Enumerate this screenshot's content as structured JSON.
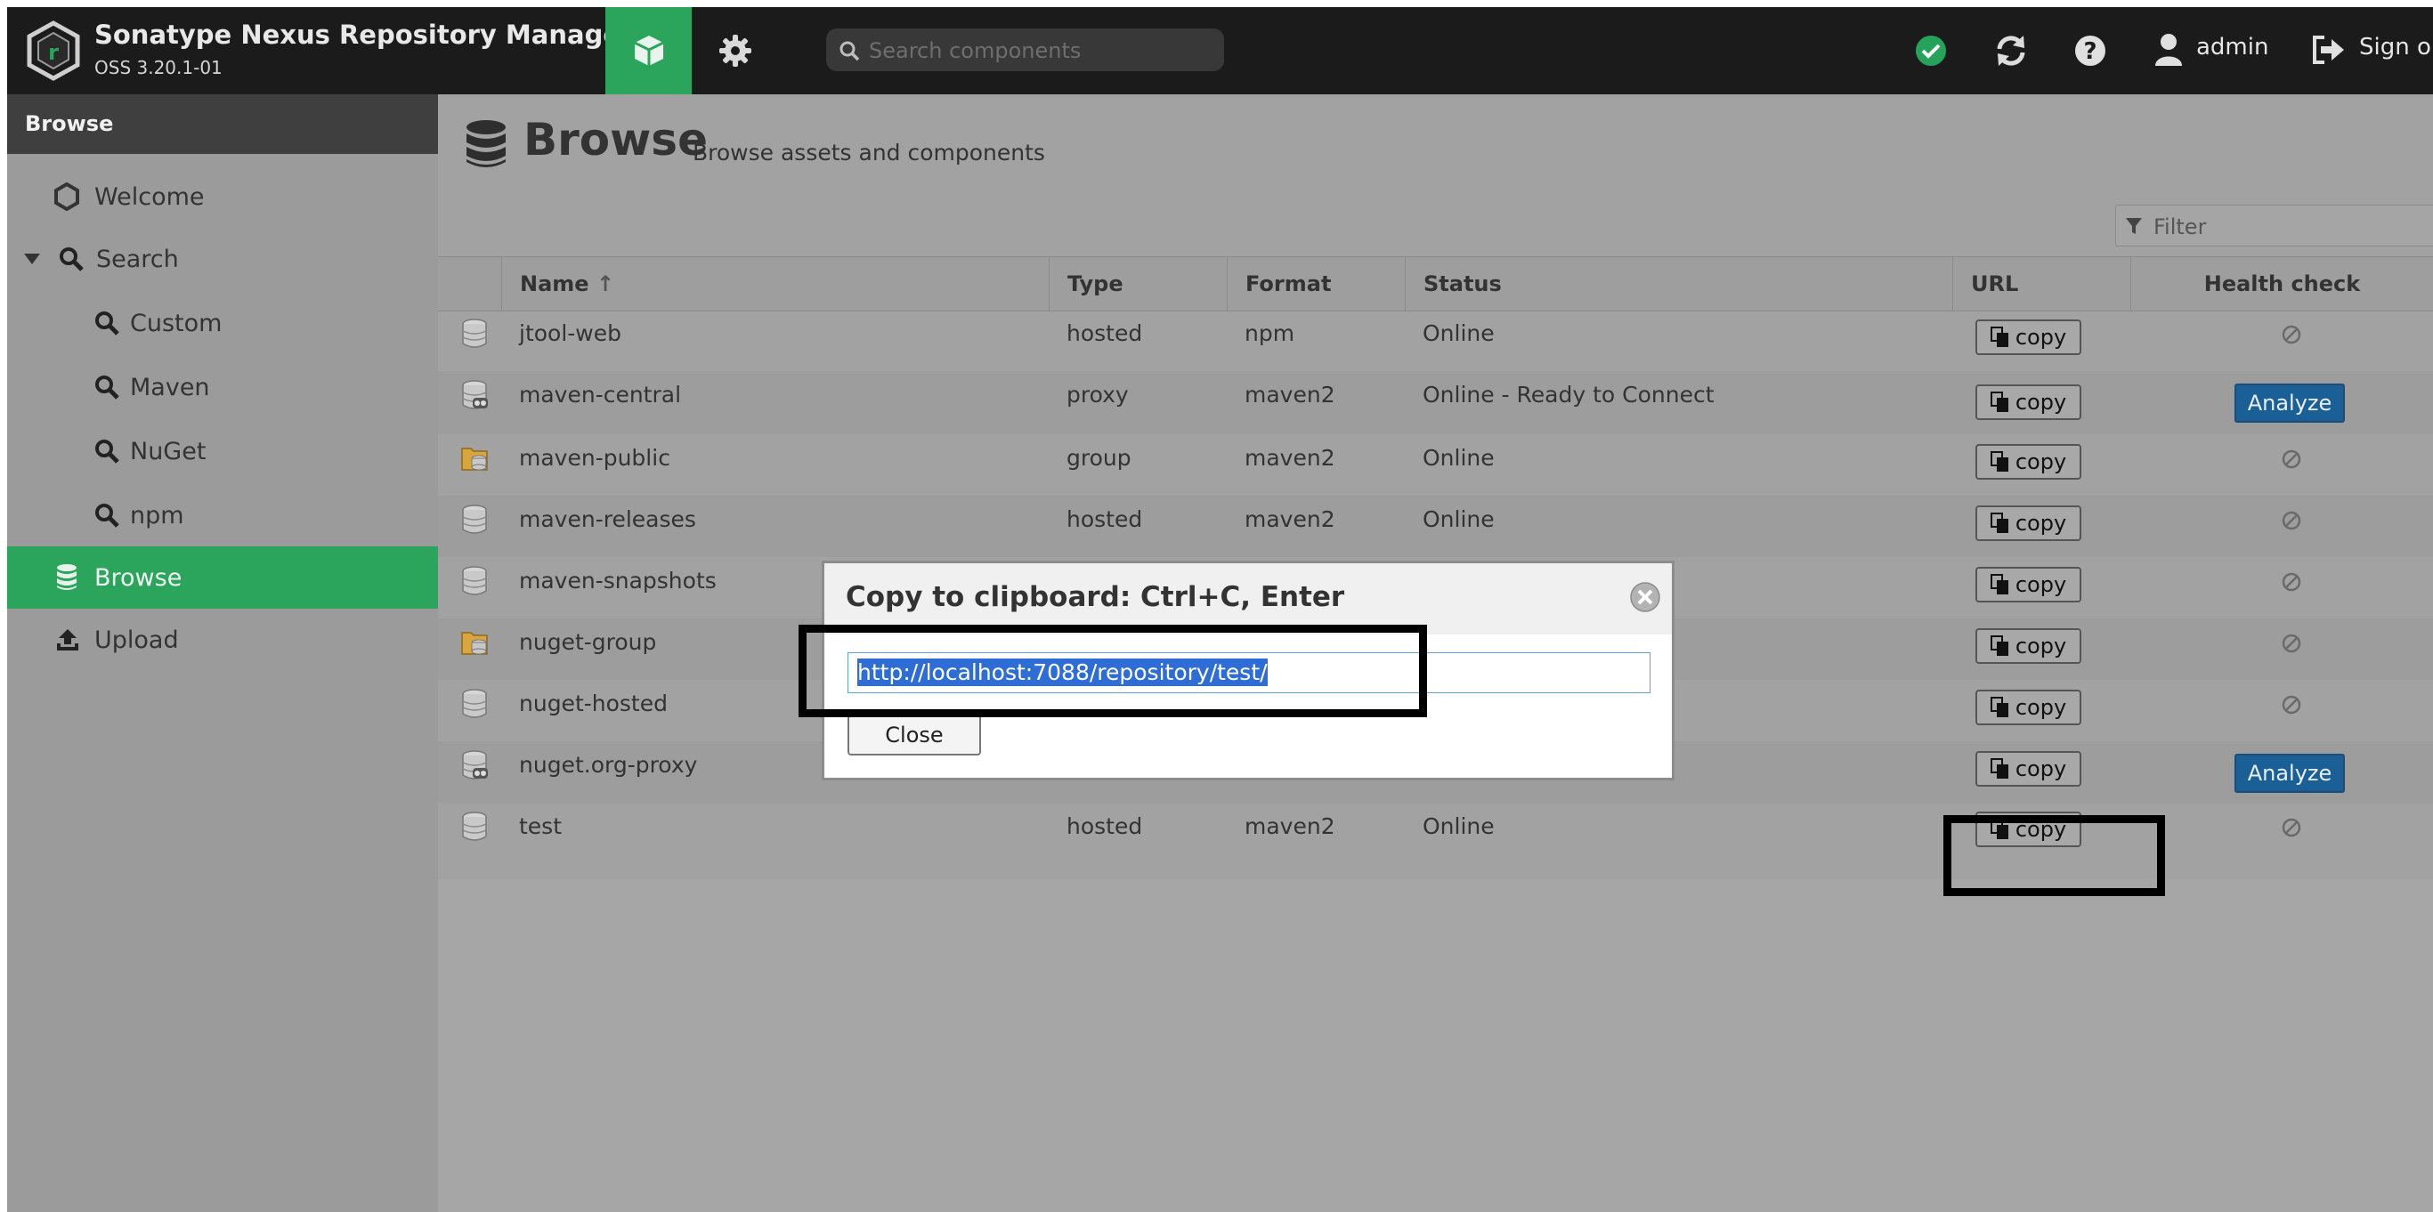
{
  "app": {
    "title": "Sonatype Nexus Repository Manager",
    "version": "OSS 3.20.1-01",
    "brand_color": "#2ba55c"
  },
  "header": {
    "nav": [
      {
        "icon": "cube-icon",
        "label": "Browse",
        "active": true
      },
      {
        "icon": "gear-icon",
        "label": "Administration",
        "active": false
      }
    ],
    "search_placeholder": "Search components",
    "status_icon": "check-circle-icon",
    "refresh_icon": "refresh-icon",
    "help_icon": "question-circle-icon",
    "user_icon": "user-icon",
    "username": "admin",
    "signout_icon": "sign-out-icon",
    "signout_label": "Sign out"
  },
  "sidebar": {
    "title": "Browse",
    "items": [
      {
        "label": "Welcome",
        "icon": "hexagon-icon"
      },
      {
        "label": "Search",
        "icon": "search-icon",
        "expanded": true
      },
      {
        "label": "Custom",
        "icon": "search-icon"
      },
      {
        "label": "Maven",
        "icon": "search-icon"
      },
      {
        "label": "NuGet",
        "icon": "search-icon"
      },
      {
        "label": "npm",
        "icon": "search-icon"
      },
      {
        "label": "Browse",
        "icon": "database-icon",
        "active": true
      },
      {
        "label": "Upload",
        "icon": "upload-icon"
      }
    ]
  },
  "page": {
    "title": "Browse",
    "subtitle": "Browse assets and components",
    "filter_placeholder": "Filter"
  },
  "table": {
    "columns": [
      "Name",
      "Type",
      "Format",
      "Status",
      "URL",
      "Health check"
    ],
    "sort_indicator": "↑",
    "copy_label": "copy",
    "analyze_label": "Analyze",
    "rows": [
      {
        "name": "jtool-web",
        "type": "hosted",
        "format": "npm",
        "status": "Online",
        "icon": "hosted-repo-icon",
        "health": "none"
      },
      {
        "name": "maven-central",
        "type": "proxy",
        "format": "maven2",
        "status": "Online - Ready to Connect",
        "icon": "proxy-repo-icon",
        "health": "analyze"
      },
      {
        "name": "maven-public",
        "type": "group",
        "format": "maven2",
        "status": "Online",
        "icon": "group-repo-icon",
        "health": "none"
      },
      {
        "name": "maven-releases",
        "type": "hosted",
        "format": "maven2",
        "status": "Online",
        "icon": "hosted-repo-icon",
        "health": "none"
      },
      {
        "name": "maven-snapshots",
        "type": "",
        "format": "",
        "status": "",
        "icon": "hosted-repo-icon",
        "health": "none"
      },
      {
        "name": "nuget-group",
        "type": "",
        "format": "",
        "status": "",
        "icon": "group-repo-icon",
        "health": "none"
      },
      {
        "name": "nuget-hosted",
        "type": "",
        "format": "",
        "status": "",
        "icon": "hosted-repo-icon",
        "health": "none"
      },
      {
        "name": "nuget.org-proxy",
        "type": "",
        "format": "",
        "status": "ct",
        "icon": "proxy-repo-icon",
        "health": "analyze"
      },
      {
        "name": "test",
        "type": "hosted",
        "format": "maven2",
        "status": "Online",
        "icon": "hosted-repo-icon",
        "health": "none"
      }
    ]
  },
  "modal": {
    "title": "Copy to clipboard: Ctrl+C, Enter",
    "url_value": "http://localhost:7088/repository/test/",
    "close_label": "Close"
  }
}
